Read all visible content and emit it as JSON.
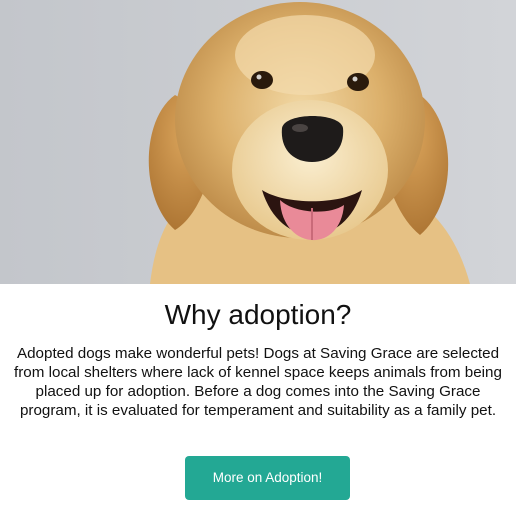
{
  "hero": {
    "image": "golden-retriever-portrait",
    "background_color": "#c7cacf"
  },
  "section": {
    "title": "Why adoption?",
    "description": "Adopted dogs make wonderful pets! Dogs at Saving Grace are selected from local shelters where lack of kennel space keeps animals from being placed up for adoption. Before a dog comes into the Saving Grace program, it is evaluated for temperament and suitability as a family pet."
  },
  "cta": {
    "label": "More on Adoption!",
    "color": "#23a894"
  }
}
